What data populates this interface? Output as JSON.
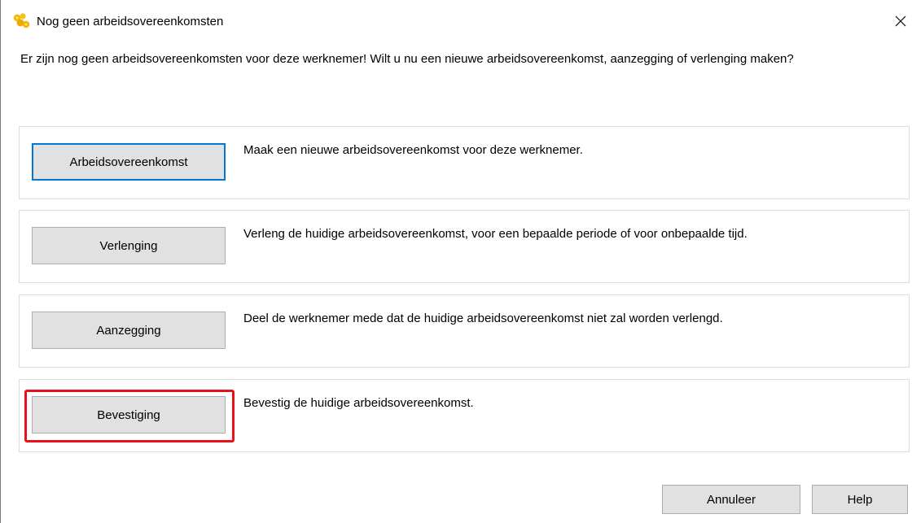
{
  "window": {
    "title": "Nog geen arbeidsovereenkomsten",
    "icon": "app-logo-icon",
    "close_icon": "close-icon"
  },
  "intro_text": "Er zijn nog geen arbeidsovereenkomsten voor deze werknemer! Wilt u nu een nieuwe arbeidsovereenkomst, aanzegging of verlenging maken?",
  "options": [
    {
      "label": "Arbeidsovereenkomst",
      "description": "Maak een nieuwe arbeidsovereenkomst voor deze werknemer."
    },
    {
      "label": "Verlenging",
      "description": "Verleng de huidige arbeidsovereenkomst, voor een bepaalde periode of voor onbepaalde tijd."
    },
    {
      "label": "Aanzegging",
      "description": "Deel de werknemer mede dat de huidige arbeidsovereenkomst niet zal worden verlengd."
    },
    {
      "label": "Bevestiging",
      "description": "Bevestig de huidige arbeidsovereenkomst."
    }
  ],
  "footer": {
    "cancel_label": "Annuleer",
    "help_label": "Help"
  },
  "colors": {
    "default_button_border": "#0078d7",
    "highlight_annotation": "#e8101a",
    "logo_yellow": "#f5b400"
  }
}
